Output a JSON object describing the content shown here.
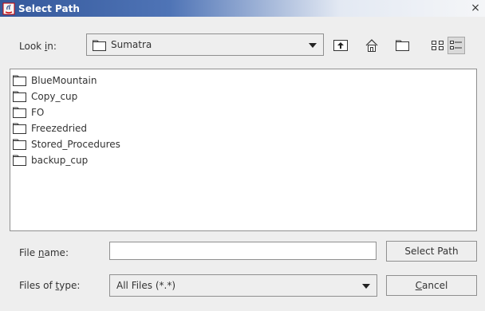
{
  "window": {
    "title": "Select Path",
    "close_glyph": "×"
  },
  "lookin": {
    "label": "Look in:",
    "mnemonic_index": 5,
    "value": "Sumatra"
  },
  "toolbar": {
    "buttons": [
      {
        "name": "up-one-level-icon"
      },
      {
        "name": "home-icon"
      },
      {
        "name": "new-folder-icon"
      },
      {
        "name": "list-view-icon"
      },
      {
        "name": "details-view-icon",
        "selected": true
      }
    ]
  },
  "files": {
    "items": [
      "BlueMountain",
      "Copy_cup",
      "FO",
      "Freezedried",
      "Stored_Procedures",
      "backup_cup"
    ]
  },
  "filename": {
    "label": "File name:",
    "mnemonic_index": 5,
    "value": ""
  },
  "filetype": {
    "label": "Files of type:",
    "mnemonic_index": 9,
    "value": "All Files (*.*)"
  },
  "buttons": {
    "select": {
      "label": "Select Path",
      "mnemonic_index": -1
    },
    "cancel": {
      "label": "Cancel",
      "mnemonic_index": 0
    }
  },
  "colors": {
    "titlebar_start": "#34589b",
    "background": "#eeeeee",
    "border": "#8f8f8f"
  }
}
